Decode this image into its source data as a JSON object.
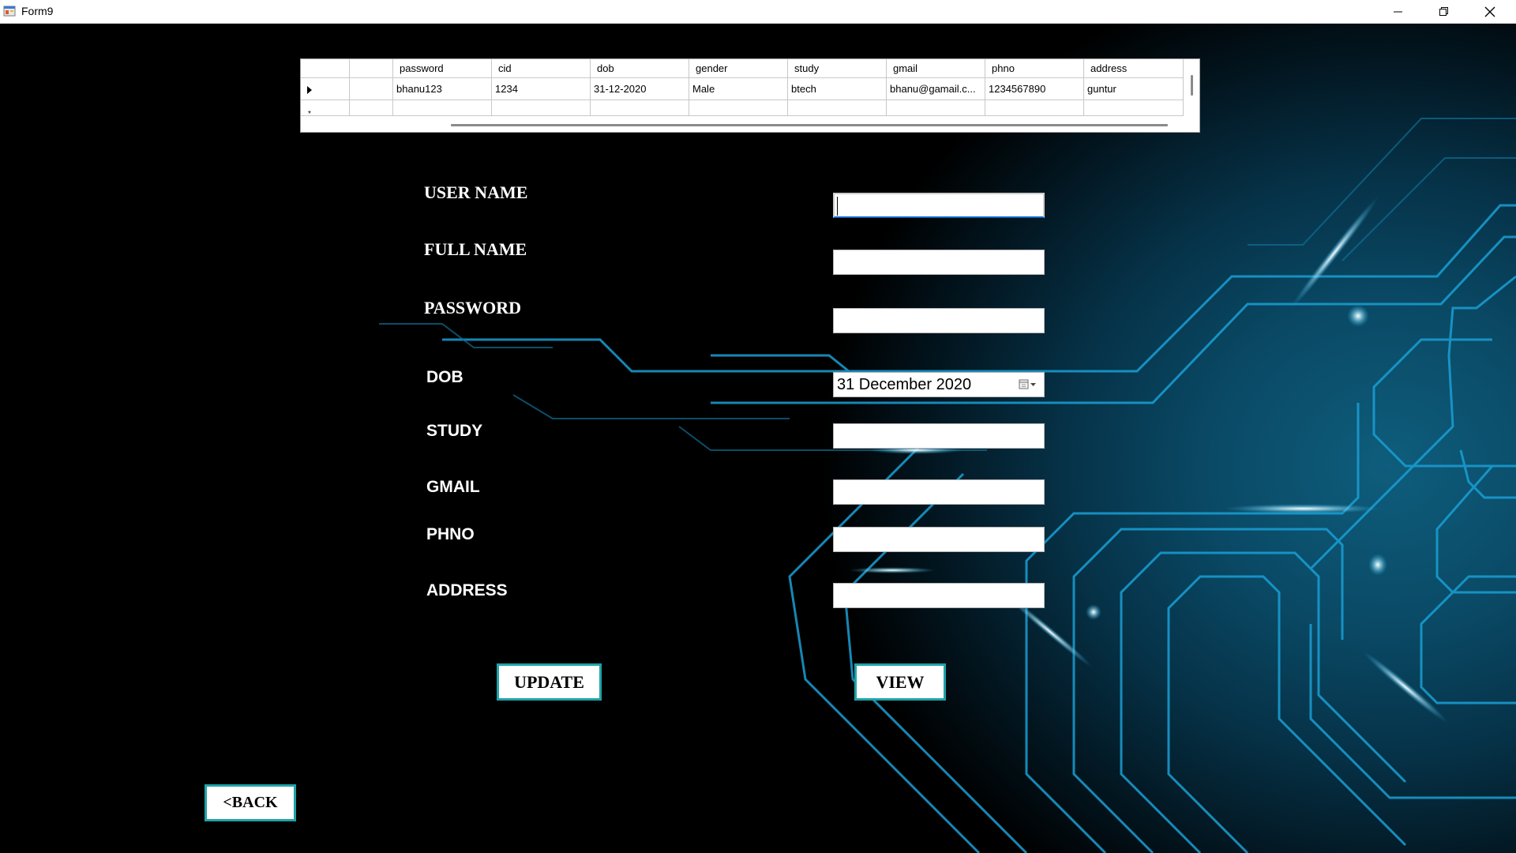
{
  "window": {
    "title": "Form9",
    "icon": "winforms-app-icon",
    "controls": [
      "minimize-icon",
      "restore-icon",
      "close-icon"
    ]
  },
  "grid": {
    "columns": [
      "",
      "password",
      "cid",
      "dob",
      "gender",
      "study",
      "gmail",
      "phno",
      "address"
    ],
    "rows": [
      [
        "",
        "bhanu123",
        "1234",
        "31-12-2020",
        "Male",
        "btech",
        "bhanu@gamail.c...",
        "1234567890",
        "guntur"
      ]
    ],
    "new_row_marker": "*"
  },
  "form": {
    "username": {
      "label": "USER NAME",
      "value": ""
    },
    "fullname": {
      "label": "FULL NAME",
      "value": ""
    },
    "password": {
      "label": "PASSWORD",
      "value": ""
    },
    "dob": {
      "label": "DOB",
      "value": "31 December 2020"
    },
    "study": {
      "label": "STUDY",
      "value": ""
    },
    "gmail": {
      "label": "GMAIL",
      "value": ""
    },
    "phno": {
      "label": "PHNO",
      "value": ""
    },
    "address": {
      "label": "ADDRESS",
      "value": ""
    }
  },
  "buttons": {
    "update": "UPDATE",
    "view": "VIEW",
    "back": "<BACK"
  },
  "colors": {
    "button_border": "#1fa3a8",
    "circuit": "#1a9fd4",
    "background_center": "#0e5d7c"
  }
}
